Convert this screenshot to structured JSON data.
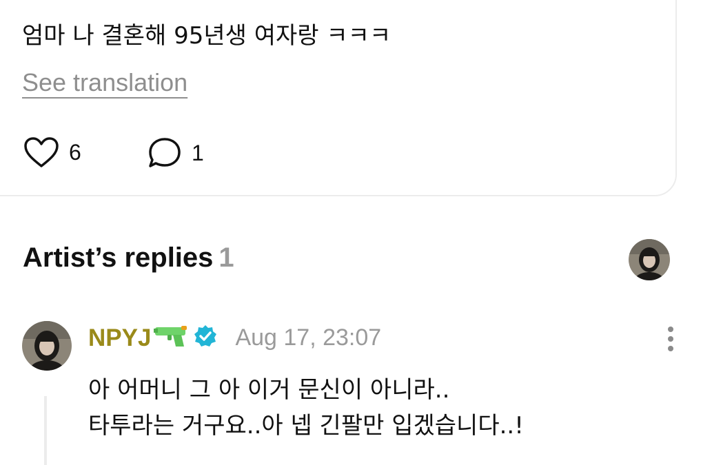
{
  "post": {
    "text": "엄마 나 결혼해 95년생 여자랑 ㅋㅋㅋ",
    "see_translation": "See translation",
    "likes": "6",
    "comments": "1"
  },
  "artist_replies": {
    "title": "Artist’s replies",
    "count": "1"
  },
  "reply": {
    "author": "NPYJ",
    "timestamp": "Aug 17, 23:07",
    "line1": "아 어머니 그 아 이거 문신이 아니라..",
    "line2": "타투라는 거구요..아 넵 긴팔만 입겠습니다..!"
  },
  "colors": {
    "author": "#9a8a1a",
    "verified": "#22b5d6",
    "muted": "#9a9a9a"
  },
  "icons": {
    "like": "heart-icon",
    "comment": "speech-bubble-icon",
    "badge": "verified-badge-icon",
    "emoji": "water-pistol-icon",
    "menu": "more-vertical-icon"
  }
}
